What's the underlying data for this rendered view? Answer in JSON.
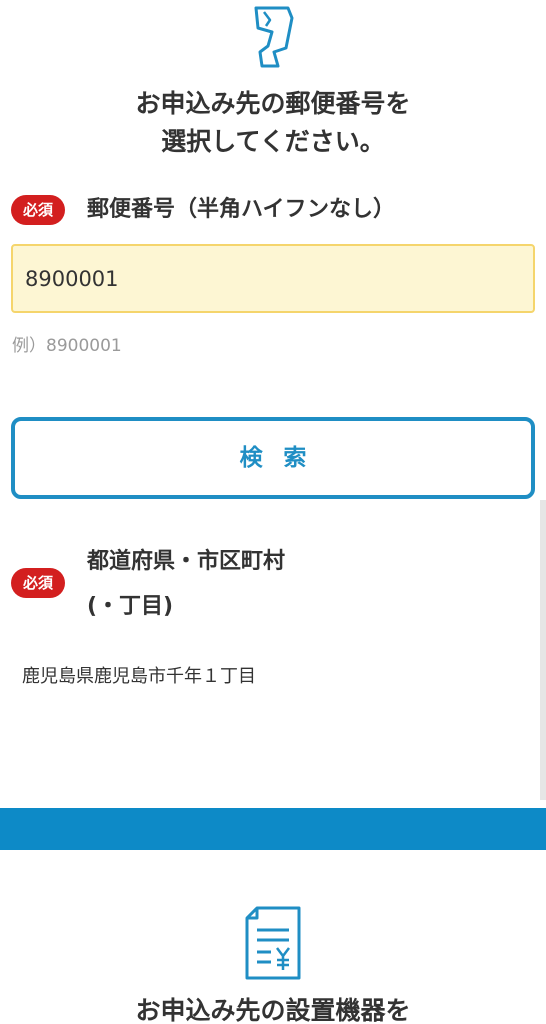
{
  "section1": {
    "title_line1": "お申込み先の郵便番号を",
    "title_line2": "選択してください。",
    "icon": "map-outline-icon"
  },
  "postal_field": {
    "required_badge": "必須",
    "label": "郵便番号（半角ハイフンなし）",
    "value": "8900001",
    "example": "例）8900001"
  },
  "search_button": {
    "label": "検索"
  },
  "address_field": {
    "required_badge": "必須",
    "label_line1": "都道府県・市区町村",
    "label_line2": "(・丁目)",
    "value": "鹿児島県鹿児島市千年１丁目"
  },
  "section2": {
    "title": "お申込み先の設置機器を",
    "icon": "document-yen-icon"
  },
  "colors": {
    "accent_blue": "#1f8ec4",
    "band_blue": "#0d8ac7",
    "required_red": "#d31f1f",
    "input_bg": "#fdf6d3",
    "input_border": "#f5d56c"
  }
}
